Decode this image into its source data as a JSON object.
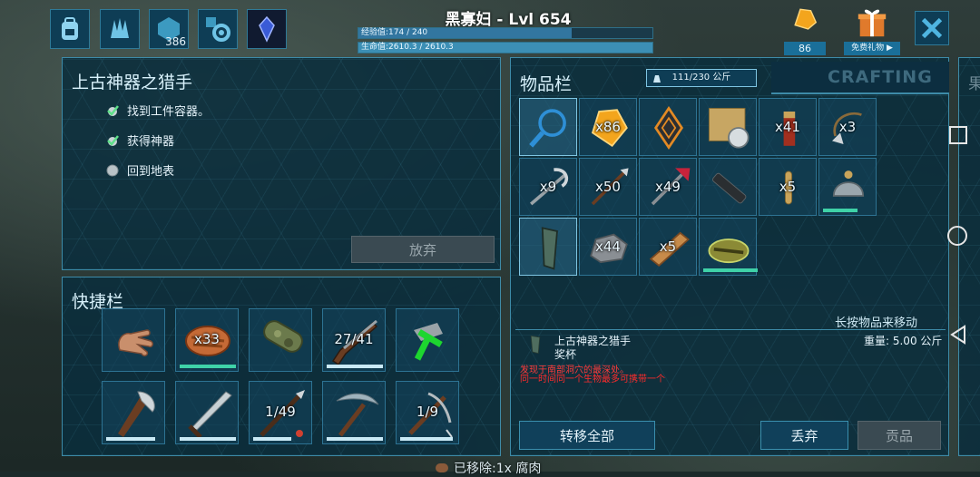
{
  "player": {
    "name_level": "黑寡妇 - Lvl 654",
    "xp": "经验值:174 / 240",
    "hp": "生命值:2610.3 / 2610.3",
    "xp_fraction": 0.725,
    "hp_fraction": 1.0
  },
  "top_icons": {
    "level_points": "386"
  },
  "top_right": {
    "amber_count": "86",
    "gift_label": "免费礼物"
  },
  "quest": {
    "title": "上古神器之猎手",
    "objectives": [
      {
        "label": "找到工件容器。",
        "done": true
      },
      {
        "label": "获得神器",
        "done": true
      },
      {
        "label": "回到地表",
        "done": false
      }
    ],
    "abandon_label": "放弃"
  },
  "hotbar": {
    "title": "快捷栏",
    "slots": [
      {
        "icon": "hand-icon",
        "qty": ""
      },
      {
        "icon": "cooked-meat-icon",
        "qty": "x33"
      },
      {
        "icon": "camo-cloth-icon",
        "qty": ""
      },
      {
        "icon": "rifle-icon",
        "qty": "27/41"
      },
      {
        "icon": "hammer-icon",
        "qty": ""
      },
      {
        "icon": "axe-icon",
        "qty": ""
      },
      {
        "icon": "sword-icon",
        "qty": ""
      },
      {
        "icon": "spear-rifle-icon",
        "qty": "1/49"
      },
      {
        "icon": "pickaxe-icon",
        "qty": ""
      },
      {
        "icon": "crossbow-icon",
        "qty": "1/9"
      }
    ]
  },
  "inventory": {
    "title": "物品栏",
    "weight": "111/230 公斤",
    "crafting_tab": "CRAFTING",
    "next_tab": "果",
    "items": [
      {
        "icon": "magnifier-icon",
        "qty": ""
      },
      {
        "icon": "amber-icon",
        "qty": "x86"
      },
      {
        "icon": "implant-icon",
        "qty": ""
      },
      {
        "icon": "map-compass-icon",
        "qty": ""
      },
      {
        "icon": "bullet-icon",
        "qty": "x41"
      },
      {
        "icon": "grapple-icon",
        "qty": "x3"
      },
      {
        "icon": "hook-icon",
        "qty": "x9"
      },
      {
        "icon": "arrow-icon",
        "qty": "x50"
      },
      {
        "icon": "tranq-dart-icon",
        "qty": "x49"
      },
      {
        "icon": "flashlight-icon",
        "qty": ""
      },
      {
        "icon": "cartridge-icon",
        "qty": "x5"
      },
      {
        "icon": "helmet-icon",
        "qty": ""
      },
      {
        "icon": "artifact-icon",
        "qty": ""
      },
      {
        "icon": "stone-icon",
        "qty": "x44"
      },
      {
        "icon": "wood-icon",
        "qty": "x5"
      },
      {
        "icon": "scope-icon",
        "qty": ""
      }
    ],
    "hint": "长按物品来移动",
    "selected_name": "上古神器之猎手",
    "selected_type": "奖杯",
    "selected_weight": "重量: 5.00 公斤",
    "desc_line1": "发现于南部洞穴的最深处。",
    "desc_line2": "同一时间同一个生物最多可携带一个",
    "transfer_all": "转移全部",
    "drop": "丢弃",
    "tribute": "贡品"
  },
  "bottom_notice": "已移除:1x 腐肉",
  "colors": {
    "panel_border": "#3d8ba8",
    "durability": "#3fd2a8",
    "warn_red": "#ff2b2b"
  }
}
